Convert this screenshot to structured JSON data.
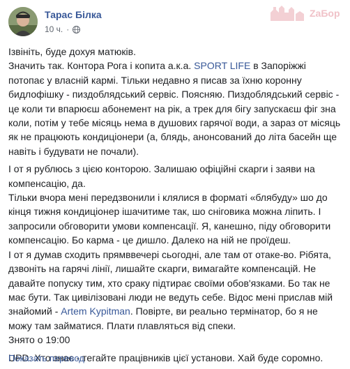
{
  "post": {
    "author": "Тарас Білка",
    "time": "10 ч.",
    "privacy_icon": "globe-icon",
    "watermark_text": "ZaБор",
    "paragraphs": [
      [
        "Ізвініть, буде дохуя матюків."
      ],
      [
        "Значить так. Контора Рога і копита а.к.а. ",
        {
          "link": "SPORT LIFE"
        },
        " в Запоріжжі потопає у власній кармі. Тільки недавно я писав за їхню коронну бидлофішку - пиздоблядський сервіс. Поясняю. Пиздоблядський сервіс - це коли ти впарюєш абонемент на рік, а трек для бігу запускаєш фіг зна коли, потім у тебе місяць нема в душових гарячої води, а зараз от місяць як не працюють кондиціонери (а, блядь, анонсований до літа басейн ще навіть і будувати не почали)."
      ],
      [
        "І от я рублюсь з цією конторою. Залишаю офіційні скарги і заяви на компенсацію, да.",
        "Тільки вчора мені передзвонили і клялися в форматі «блябуду» шо до кінця тижня кондиціонер ішачитиме так, шо сніговика можна ліпить. І запросили обговорити умови компенсації. Я, канешно, піду обговорити компенсацію. Бо карма - це дишло. Далеко на ній не проїдеш.",
        "І от я думав сходить прямввечері сьогодні, але там от отаке-во. Рібята, дзвоніть на гарячі лінії, лишайте скарги, вимагайте компенсацій. Не давайте попуску тим, хто сраку підтирає своїми обов'язками. Бо так не має бути. Так цивілізовані люди не ведуть себе. Відос мені прислав мій знайомий - ",
        {
          "link": "Artem Kypitman"
        },
        ". Повірте, ви реально термінатор, бо я не можу там займатися. Плати плавляться від спеки.",
        "Знято о 19:00"
      ],
      [
        "UPD. Хто знає - тегайте працівників цієї установи. Хай буде соромно."
      ]
    ],
    "translate_label": "Показать перевод"
  }
}
